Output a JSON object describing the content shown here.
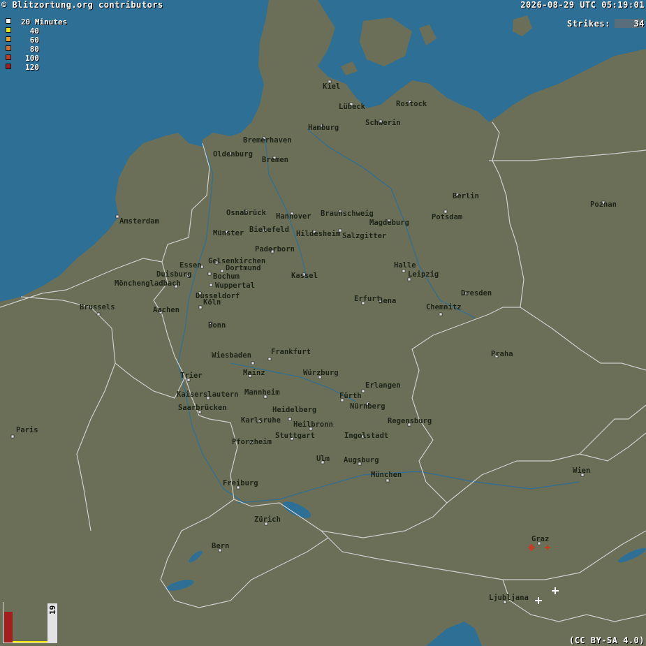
{
  "header": {
    "copyright": "© Blitzortung.org contributors",
    "timestamp": "2026-08-29 UTC 05:19:01"
  },
  "strikes": {
    "label": "Strikes:",
    "value": "34"
  },
  "legend": [
    {
      "label": "20 Minutes",
      "color": "#ffffff"
    },
    {
      "label": "40",
      "color": "#f1e600"
    },
    {
      "label": "60",
      "color": "#e5a11e"
    },
    {
      "label": "80",
      "color": "#d3702a"
    },
    {
      "label": "100",
      "color": "#c63b26"
    },
    {
      "label": "120",
      "color": "#a31e1e"
    }
  ],
  "histogram": {
    "value": "19"
  },
  "license": "(CC BY-SA 4.0)",
  "colors": {
    "land": "#6b6f57",
    "water": "#2e6f96",
    "border": "#d9d9d9",
    "river": "#2e6f96"
  },
  "cities": [
    {
      "name": "Kiel"
    },
    {
      "name": "Lübeck"
    },
    {
      "name": "Rostock"
    },
    {
      "name": "Hamburg"
    },
    {
      "name": "Schwerin"
    },
    {
      "name": "Bremerhaven"
    },
    {
      "name": "Oldenburg"
    },
    {
      "name": "Bremen"
    },
    {
      "name": "Berlin"
    },
    {
      "name": "Potsdam"
    },
    {
      "name": "Poznan"
    },
    {
      "name": "Amsterdam"
    },
    {
      "name": "Osnabrück"
    },
    {
      "name": "Hannover"
    },
    {
      "name": "Braunschweig"
    },
    {
      "name": "Magdeburg"
    },
    {
      "name": "Münster"
    },
    {
      "name": "Bielefeld"
    },
    {
      "name": "Hildesheim"
    },
    {
      "name": "Salzgitter"
    },
    {
      "name": "Paderborn"
    },
    {
      "name": "Gelsenkirchen"
    },
    {
      "name": "Essen"
    },
    {
      "name": "Dortmund"
    },
    {
      "name": "Duisburg"
    },
    {
      "name": "Bochum"
    },
    {
      "name": "Wuppertal"
    },
    {
      "name": "Mönchengladbach"
    },
    {
      "name": "Düsseldorf"
    },
    {
      "name": "Kassel"
    },
    {
      "name": "Halle"
    },
    {
      "name": "Leipzig"
    },
    {
      "name": "Brussels"
    },
    {
      "name": "Aachen"
    },
    {
      "name": "Köln"
    },
    {
      "name": "Bonn"
    },
    {
      "name": "Erfurt"
    },
    {
      "name": "Jena"
    },
    {
      "name": "Chemnitz"
    },
    {
      "name": "Dresden"
    },
    {
      "name": "Praha"
    },
    {
      "name": "Wiesbaden"
    },
    {
      "name": "Frankfurt"
    },
    {
      "name": "Trier"
    },
    {
      "name": "Mainz"
    },
    {
      "name": "Würzburg"
    },
    {
      "name": "Erlangen"
    },
    {
      "name": "Kaiserslautern"
    },
    {
      "name": "Mannheim"
    },
    {
      "name": "Fürth"
    },
    {
      "name": "Nürnberg"
    },
    {
      "name": "Saarbrücken"
    },
    {
      "name": "Heidelberg"
    },
    {
      "name": "Karlsruhe"
    },
    {
      "name": "Heilbronn"
    },
    {
      "name": "Regensburg"
    },
    {
      "name": "Paris"
    },
    {
      "name": "Stuttgart"
    },
    {
      "name": "Ingolstadt"
    },
    {
      "name": "Pforzheim"
    },
    {
      "name": "Ulm"
    },
    {
      "name": "Augsburg"
    },
    {
      "name": "München"
    },
    {
      "name": "Wien"
    },
    {
      "name": "Freiburg"
    },
    {
      "name": "Zürich"
    },
    {
      "name": "Graz"
    },
    {
      "name": "Bern"
    },
    {
      "name": "Ljubljana"
    }
  ]
}
